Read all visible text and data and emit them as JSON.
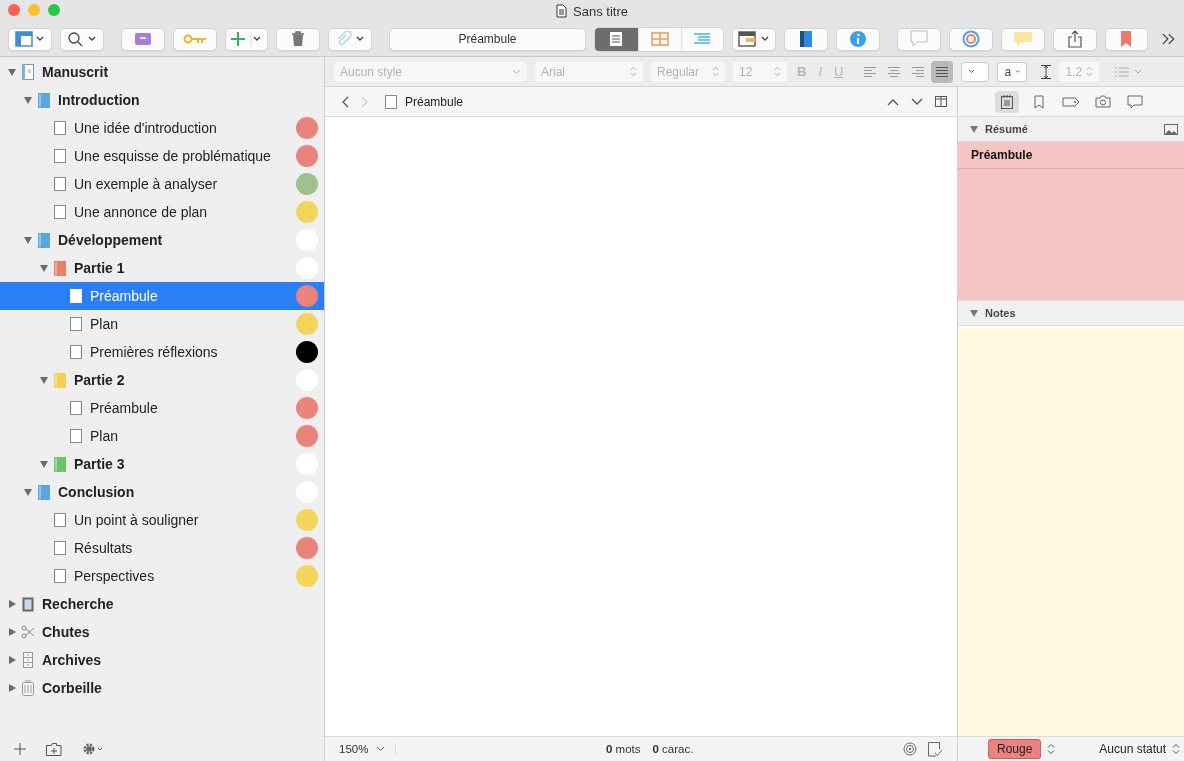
{
  "window": {
    "title": "Sans titre"
  },
  "toolbar": {
    "title_field": "Préambule",
    "view_modes": [
      {
        "selected": true
      },
      {
        "selected": false
      },
      {
        "selected": false
      }
    ]
  },
  "format_bar": {
    "disabled": true,
    "style": "Aucun style",
    "font": "Arial",
    "weight": "Regular",
    "size": "12",
    "bold": "B",
    "italic": "I",
    "underline": "U",
    "alignments": [
      {
        "selected": false
      },
      {
        "selected": false
      },
      {
        "selected": false
      },
      {
        "selected": true
      }
    ],
    "highlight": "a",
    "line_spacing": "1.2"
  },
  "binder": [
    {
      "title": "Manuscrit",
      "kind": "draft",
      "expanded": true,
      "selected": false,
      "children": [
        {
          "title": "Introduction",
          "kind": "folder",
          "icon": {
            "color": "#5aa6e0"
          },
          "expanded": true,
          "selected": false,
          "children": [
            {
              "title": "Une idée d'introduction",
              "kind": "text",
              "color": "#e9837c",
              "selected": false
            },
            {
              "title": "Une esquisse de problématique",
              "kind": "text",
              "color": "#e9837c",
              "selected": false
            },
            {
              "title": "Un exemple à analyser",
              "kind": "text",
              "color": "#9fc18f",
              "selected": false
            },
            {
              "title": "Une annonce de plan",
              "kind": "text",
              "color": "#f2d55a",
              "selected": false
            }
          ]
        },
        {
          "title": "Développement",
          "kind": "folder",
          "icon": {
            "color": "#5aa6e0"
          },
          "color": "#ffffff",
          "expanded": true,
          "selected": false,
          "children": [
            {
              "title": "Partie 1",
              "kind": "folder",
              "icon": {
                "color": "#e8806a"
              },
              "color": "#ffffff",
              "expanded": true,
              "selected": false,
              "children": [
                {
                  "title": "Préambule",
                  "kind": "text",
                  "color": "#e9837c",
                  "selected": true
                },
                {
                  "title": "Plan",
                  "kind": "text",
                  "color": "#f2d55a",
                  "selected": false
                },
                {
                  "title": "Premières réflexions",
                  "kind": "text",
                  "color": "#000000",
                  "selected": false
                }
              ]
            },
            {
              "title": "Partie 2",
              "kind": "folder",
              "icon": {
                "color": "#f2cf55"
              },
              "color": "#ffffff",
              "expanded": true,
              "selected": false,
              "children": [
                {
                  "title": "Préambule",
                  "kind": "text",
                  "color": "#e9837c",
                  "selected": false
                },
                {
                  "title": "Plan",
                  "kind": "text",
                  "color": "#e9837c",
                  "selected": false
                }
              ]
            },
            {
              "title": "Partie 3",
              "kind": "folder",
              "icon": {
                "color": "#6cc46a"
              },
              "color": "#ffffff",
              "expanded": true,
              "selected": false
            }
          ]
        },
        {
          "title": "Conclusion",
          "kind": "folder",
          "icon": {
            "color": "#5aa6e0"
          },
          "color": "#ffffff",
          "expanded": true,
          "selected": false,
          "children": [
            {
              "title": "Un point à souligner",
              "kind": "text",
              "color": "#f2d55a",
              "selected": false
            },
            {
              "title": "Résultats",
              "kind": "text",
              "color": "#e9837c",
              "selected": false
            },
            {
              "title": "Perspectives",
              "kind": "text",
              "color": "#f2d55a",
              "selected": false
            }
          ]
        }
      ]
    },
    {
      "title": "Recherche",
      "kind": "research",
      "expanded": false,
      "selected": false
    },
    {
      "title": "Chutes",
      "kind": "snippets",
      "expanded": false,
      "selected": false
    },
    {
      "title": "Archives",
      "kind": "archive",
      "expanded": false,
      "selected": false
    },
    {
      "title": "Corbeille",
      "kind": "trash",
      "expanded": false,
      "selected": false
    }
  ],
  "editor": {
    "title": "Préambule",
    "zoom": "150%",
    "words": "**0** mots",
    "chars": "**0** carac."
  },
  "inspector": {
    "tabs": [
      {
        "selected": true
      },
      {
        "selected": false
      },
      {
        "selected": false
      },
      {
        "selected": false
      },
      {
        "selected": false
      }
    ],
    "synopsis": {
      "heading": "Résumé",
      "expanded": true,
      "text": "Préambule"
    },
    "notes": {
      "heading": "Notes",
      "expanded": true
    },
    "label": {
      "text": "Rouge",
      "color": "#e9837c"
    },
    "status": "Aucun statut"
  }
}
